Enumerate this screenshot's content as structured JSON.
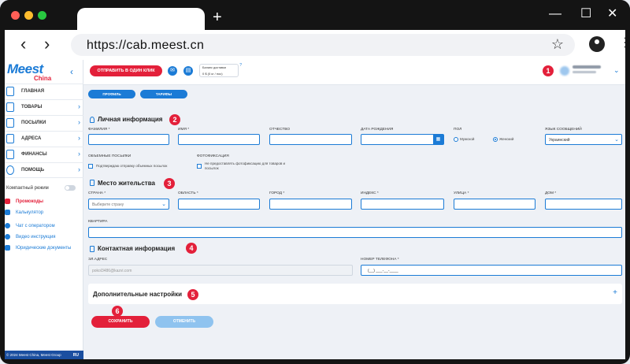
{
  "browser": {
    "url": "https://cab.meest.cn",
    "new_tab": "+",
    "controls": {
      "minimize": "—",
      "maximize": "☐",
      "close": "✕"
    },
    "nav": {
      "back": "‹",
      "forward": "›"
    },
    "colors": {
      "close": "#ff5f57",
      "minimize": "#febc2e",
      "maximize": "#28c840"
    }
  },
  "logo": {
    "brand": "Meest",
    "sub": "China"
  },
  "sidebar": {
    "items": [
      {
        "label": "ГЛАВНАЯ",
        "icon": "home-icon"
      },
      {
        "label": "ТОВАРЫ",
        "icon": "box-icon"
      },
      {
        "label": "ПОСЫЛКИ",
        "icon": "parcel-icon"
      },
      {
        "label": "АДРЕСА",
        "icon": "address-icon"
      },
      {
        "label": "ФИНАНСЫ",
        "icon": "finance-icon"
      },
      {
        "label": "ПОМОЩЬ",
        "icon": "help-icon"
      }
    ],
    "compact_mode": "Компактный режим",
    "links": [
      {
        "label": "Промокоды",
        "accent": true
      },
      {
        "label": "Калькулятор",
        "accent": false
      },
      {
        "label": "Чат с оператором",
        "accent": false
      },
      {
        "label": "Видео инструкция",
        "accent": false
      },
      {
        "label": "Юридические документы",
        "accent": false
      }
    ],
    "footer": "© 2024 Meest China, Meest Group",
    "lang": "RU"
  },
  "topbar": {
    "send_button": "ОТПРАВИТЬ В ОДИН КЛИК",
    "balance_title": "Баланс доставки",
    "balance_value": "0 $ (0 кг / пос)",
    "help": "?"
  },
  "tabs": {
    "profile": "ПРОФИЛЬ",
    "tariffs": "ТАРИФЫ"
  },
  "badges": [
    "1",
    "2",
    "3",
    "4",
    "5",
    "6"
  ],
  "personal": {
    "title": "Личная информация",
    "last_name": "ФАМИЛИЯ *",
    "first_name": "ИМЯ *",
    "patronymic": "ОТЧЕСТВО",
    "birth_date": "ДАТА РОЖДЕНИЯ",
    "gender": "ПОЛ",
    "male": "Мужской",
    "female": "Женский",
    "language": "ЯЗЫК СООБЩЕНИЙ",
    "language_value": "Украинский",
    "volume_title": "ОБЪЕМНЫЕ ПОСЫЛКИ",
    "volume_check": "Подтверждаю отправку объемных посылок",
    "photo_title": "ФОТОФИКСАЦИЯ",
    "photo_check": "Не предоставлять фотофиксацию для товаров и посылок"
  },
  "residence": {
    "title": "Место жительства",
    "country": "СТРАНА *",
    "country_placeholder": "Выберите страну",
    "region": "ОБЛАСТЬ *",
    "city": "ГОРОД *",
    "index": "ИНДЕКС *",
    "street": "УЛИЦА *",
    "house": "ДОМ *",
    "apartment": "КВАРТИРА"
  },
  "contact": {
    "title": "Контактная информация",
    "email": "ЭЛ.АДРЕС",
    "email_value": "pokol3486@kazvi.com",
    "phone": "НОМЕР ТЕЛЕФОНА *",
    "phone_value": "(__) ___-__-____"
  },
  "additional": {
    "title": "Дополнительные настройки",
    "plus": "+"
  },
  "actions": {
    "save": "СОХРАНИТЬ",
    "cancel": "ОТМЕНИТЬ"
  },
  "accent_colors": {
    "blue": "#1b7bd6",
    "red": "#e3203a"
  }
}
